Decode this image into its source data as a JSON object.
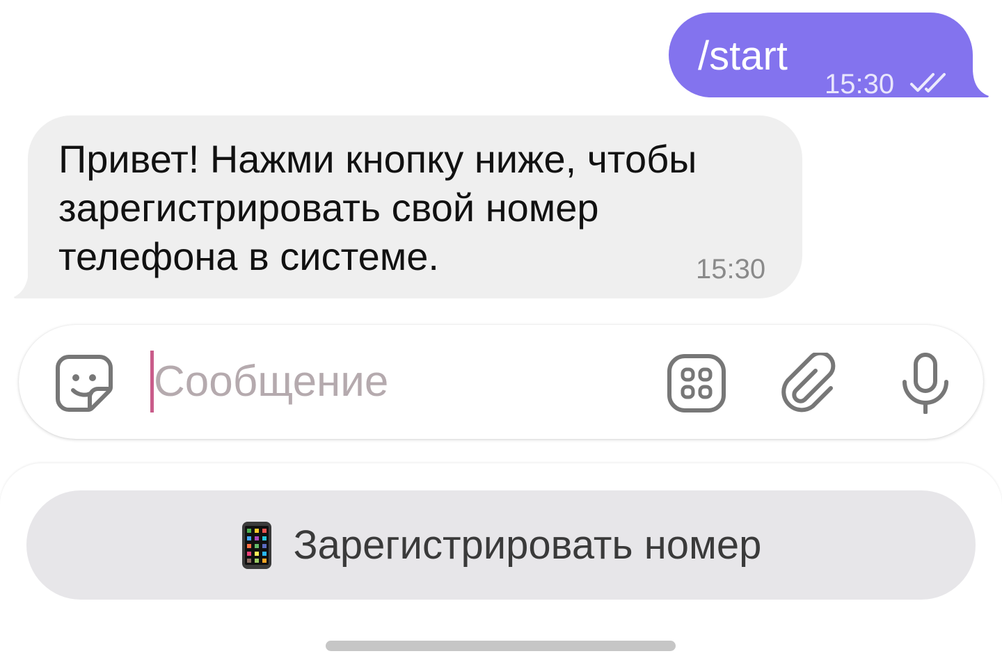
{
  "chat": {
    "outgoing": {
      "text": "/start",
      "time": "15:30",
      "status_icon": "double-check-icon"
    },
    "incoming": {
      "text": "Привет! Нажми кнопку ниже, чтобы\nзарегистрировать свой номер\nтелефона в системе.",
      "time": "15:30"
    }
  },
  "composer": {
    "placeholder": "Сообщение",
    "icons": [
      "sticker-icon",
      "bot-menu-icon",
      "paperclip-icon",
      "microphone-icon"
    ]
  },
  "reply_keyboard": {
    "button_label": "Зарегистрировать номер",
    "button_icon": "mobile-phone-icon"
  },
  "colors": {
    "outgoing_bubble": "#8373ee",
    "incoming_bubble": "#efefef",
    "keyboard_button": "#e7e6e9",
    "cursor": "#c95c8a"
  }
}
